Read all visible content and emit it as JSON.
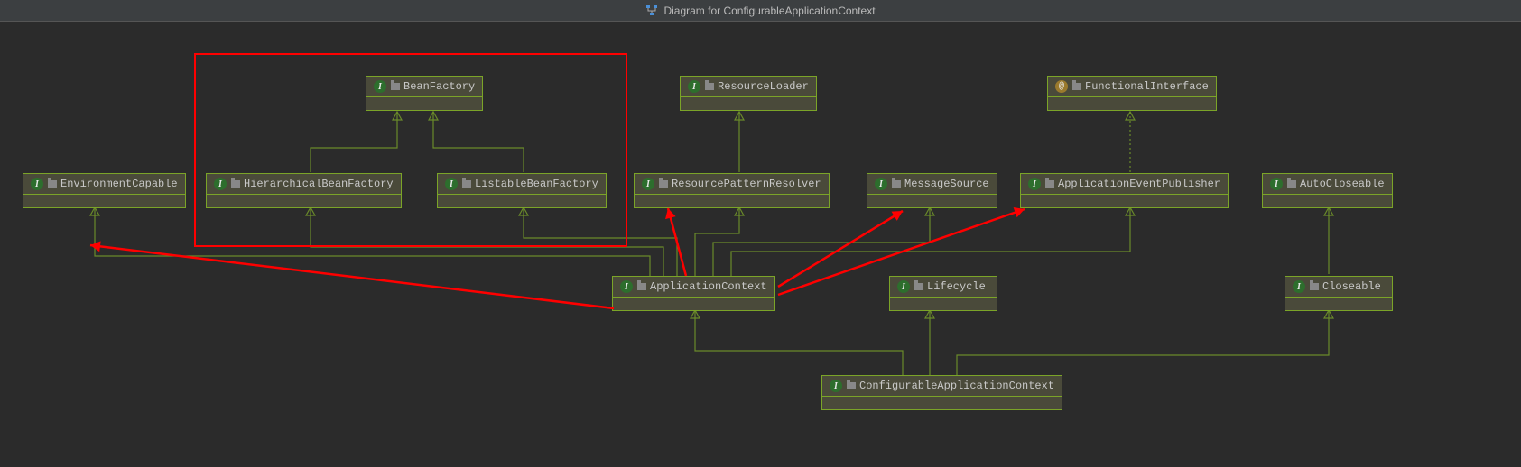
{
  "title": "Diagram for ConfigurableApplicationContext",
  "nodes": {
    "beanFactory": {
      "label": "BeanFactory",
      "icon": "interface"
    },
    "resourceLoader": {
      "label": "ResourceLoader",
      "icon": "interface"
    },
    "functionalInterface": {
      "label": "FunctionalInterface",
      "icon": "annotation"
    },
    "environmentCapable": {
      "label": "EnvironmentCapable",
      "icon": "interface"
    },
    "hierarchicalBeanFactory": {
      "label": "HierarchicalBeanFactory",
      "icon": "interface"
    },
    "listableBeanFactory": {
      "label": "ListableBeanFactory",
      "icon": "interface"
    },
    "resourcePatternResolver": {
      "label": "ResourcePatternResolver",
      "icon": "interface"
    },
    "messageSource": {
      "label": "MessageSource",
      "icon": "interface"
    },
    "applicationEventPublisher": {
      "label": "ApplicationEventPublisher",
      "icon": "interface"
    },
    "autoCloseable": {
      "label": "AutoCloseable",
      "icon": "interface"
    },
    "applicationContext": {
      "label": "ApplicationContext",
      "icon": "interface"
    },
    "lifecycle": {
      "label": "Lifecycle",
      "icon": "interface"
    },
    "closeable": {
      "label": "Closeable",
      "icon": "interface"
    },
    "configurableApplicationContext": {
      "label": "ConfigurableApplicationContext",
      "icon": "interface"
    }
  },
  "relations": [
    {
      "from": "hierarchicalBeanFactory",
      "to": "beanFactory",
      "style": "solid"
    },
    {
      "from": "listableBeanFactory",
      "to": "beanFactory",
      "style": "solid"
    },
    {
      "from": "resourcePatternResolver",
      "to": "resourceLoader",
      "style": "solid"
    },
    {
      "from": "applicationEventPublisher",
      "to": "functionalInterface",
      "style": "dotted"
    },
    {
      "from": "closeable",
      "to": "autoCloseable",
      "style": "solid"
    },
    {
      "from": "applicationContext",
      "to": "environmentCapable",
      "style": "solid"
    },
    {
      "from": "applicationContext",
      "to": "hierarchicalBeanFactory",
      "style": "solid"
    },
    {
      "from": "applicationContext",
      "to": "listableBeanFactory",
      "style": "solid"
    },
    {
      "from": "applicationContext",
      "to": "resourcePatternResolver",
      "style": "solid"
    },
    {
      "from": "applicationContext",
      "to": "messageSource",
      "style": "solid"
    },
    {
      "from": "applicationContext",
      "to": "applicationEventPublisher",
      "style": "solid"
    },
    {
      "from": "configurableApplicationContext",
      "to": "applicationContext",
      "style": "solid"
    },
    {
      "from": "configurableApplicationContext",
      "to": "lifecycle",
      "style": "solid"
    },
    {
      "from": "configurableApplicationContext",
      "to": "closeable",
      "style": "solid"
    }
  ],
  "highlights": {
    "box": {
      "around": [
        "beanFactory",
        "hierarchicalBeanFactory",
        "listableBeanFactory"
      ]
    },
    "arrows": [
      {
        "from": "applicationContext",
        "to": "environmentCapable"
      },
      {
        "from": "applicationContext",
        "to": "resourcePatternResolver"
      },
      {
        "from": "applicationContext",
        "to": "messageSource"
      },
      {
        "from": "applicationContext",
        "to": "applicationEventPublisher"
      }
    ]
  },
  "colors": {
    "edge": "#6a8a2a",
    "nodeBorder": "#7ba428",
    "nodeFill": "#4a4a3a",
    "highlight": "#ff0000",
    "background": "#2b2b2b"
  }
}
